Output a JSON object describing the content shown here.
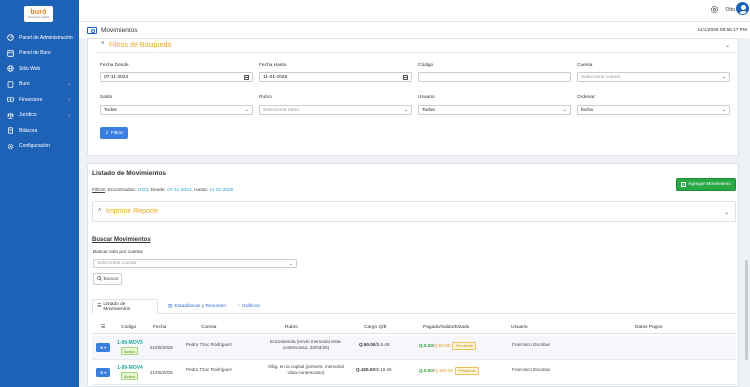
{
  "sidebar": {
    "logo": "buró",
    "logo_sub": "Sistema de gestión",
    "items": [
      {
        "label": "Panel de Administración",
        "icon": "dashboard-icon",
        "chevron": false
      },
      {
        "label": "Panel de Buro",
        "icon": "panel-icon",
        "chevron": false
      },
      {
        "label": "Sitio Web",
        "icon": "globe-icon",
        "chevron": false
      },
      {
        "label": "Buro",
        "icon": "buro-icon",
        "chevron": true
      },
      {
        "label": "Financiero",
        "icon": "money-icon",
        "chevron": true
      },
      {
        "label": "Jurídico",
        "icon": "legal-icon",
        "chevron": true
      },
      {
        "label": "Bitácora",
        "icon": "log-icon",
        "chevron": false
      },
      {
        "label": "Configuración",
        "icon": "gear-icon",
        "chevron": false
      }
    ]
  },
  "topbar": {
    "user": "Otto"
  },
  "page": {
    "title": "Movimientos",
    "datetime": "11/1/2026 08:56:17 PM"
  },
  "filters": {
    "title": "Filtros de Búsqueda",
    "fecha_desde": {
      "label": "Fecha Desde",
      "value": "07-11-2024"
    },
    "fecha_hasta": {
      "label": "Fecha Hasta",
      "value": "11-01-2026"
    },
    "codigo": {
      "label": "Código",
      "value": ""
    },
    "cuenta": {
      "label": "Cuenta",
      "placeholder": "Seleccione cuenta"
    },
    "saldo": {
      "label": "Saldo",
      "value": "Todos"
    },
    "rubro": {
      "label": "Rubro",
      "placeholder": "Seleccione rubro"
    },
    "usuario": {
      "label": "Usuario",
      "value": "Todos"
    },
    "ordenar": {
      "label": "Ordenar:",
      "value": "fecha"
    },
    "button": "Filtrar"
  },
  "list": {
    "title": "Listado de Movimientos",
    "add_button": "Agregar Movimiento",
    "filtros_label": "Filtros",
    "encontrados_label": ": Encontrados:",
    "encontrados": "1023",
    "desde_label": ", Desde:",
    "desde": "07-11-2024",
    "hasta_label": ", Hasta:",
    "hasta": "11-01-2026",
    "print_title": "Imprimir Reporte",
    "search_title": "Buscar Movimientos",
    "search_label": "Buscar solo por cuenta:",
    "search_placeholder": "Seleccione cuenta",
    "search_button": "Buscar",
    "tabs": [
      "Listado de Movimientos",
      "Estadísticas y Resumen",
      "Gráficos"
    ],
    "columns": [
      "Código",
      "Fecha",
      "Cuenta",
      "Rubro",
      "Cargo Q/$",
      "Pagado/Saldo/Estado",
      "Usuario",
      "Datos Pagos"
    ],
    "rows": [
      {
        "codigo": "1-99-MOV5",
        "estado": "Activo",
        "fecha": "21/05/2025",
        "cuenta": "Pedro Tzoc Rodríguez",
        "rubro1": "Encomienda (envío memorial vista-",
        "rubro2": "contencioso, 22/04/25)",
        "cargo_q": "Q.50.00",
        "cargo_usd": "$.6.49",
        "pagado": "Q.0.00",
        "saldo": "Q.50.00",
        "pendiente": "Pendiente",
        "usuario": "Francisco Escobar"
      },
      {
        "codigo": "1-99-MOV4",
        "estado": "Activo",
        "fecha": "21/05/2025",
        "cuenta": "Pedro Tzoc Rodríguez",
        "rubro1": "Dilig. en la capital (present. memorial",
        "rubro2": "vista-contencioso)",
        "cargo_q": "Q.150.00",
        "cargo_usd": "$.19.46",
        "pagado": "Q.0.00",
        "saldo": "Q.150.00",
        "pendiente": "Pendiente",
        "usuario": "Francisco Escobar"
      }
    ]
  }
}
